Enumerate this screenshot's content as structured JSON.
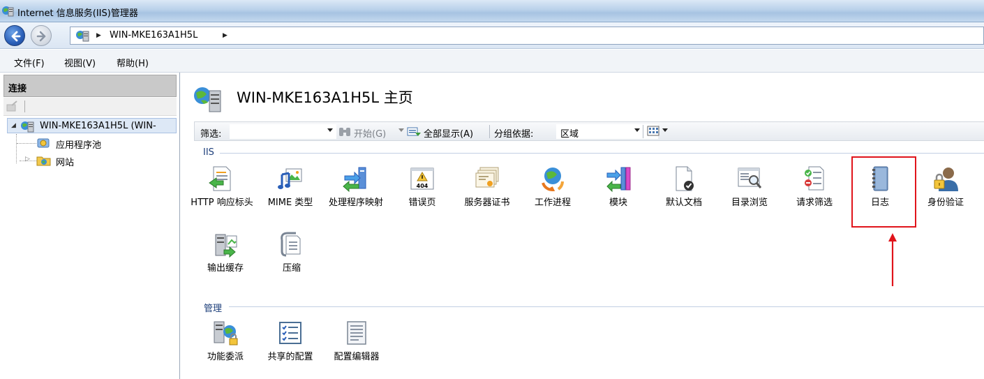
{
  "window": {
    "title": "Internet 信息服务(IIS)管理器"
  },
  "address": {
    "crumb": "WIN-MKE163A1H5L"
  },
  "menu": [
    {
      "label": "文件(F)"
    },
    {
      "label": "视图(V)"
    },
    {
      "label": "帮助(H)"
    }
  ],
  "connections": {
    "header": "连接",
    "tree": {
      "server": "WIN-MKE163A1H5L (WIN-",
      "app_pools": "应用程序池",
      "sites": "网站"
    }
  },
  "main": {
    "title": "WIN-MKE163A1H5L 主页",
    "filter": {
      "label": "筛选:",
      "value": "",
      "go": "开始(G)",
      "show_all": "全部显示(A)",
      "group_by_label": "分组依据:",
      "group_by_value": "区域"
    },
    "groups": {
      "iis": {
        "title": "IIS",
        "items": [
          {
            "label": "HTTP 响应标头",
            "icon": "http-headers-icon"
          },
          {
            "label": "MIME 类型",
            "icon": "mime-icon"
          },
          {
            "label": "处理程序映射",
            "icon": "handler-icon"
          },
          {
            "label": "错误页",
            "icon": "error-page-icon"
          },
          {
            "label": "服务器证书",
            "icon": "certificate-icon"
          },
          {
            "label": "工作进程",
            "icon": "worker-process-icon"
          },
          {
            "label": "模块",
            "icon": "modules-icon"
          },
          {
            "label": "默认文档",
            "icon": "default-document-icon"
          },
          {
            "label": "目录浏览",
            "icon": "directory-browse-icon"
          },
          {
            "label": "请求筛选",
            "icon": "request-filter-icon"
          },
          {
            "label": "日志",
            "icon": "logging-icon"
          },
          {
            "label": "身份验证",
            "icon": "authentication-icon"
          },
          {
            "label": "输出缓存",
            "icon": "output-cache-icon"
          },
          {
            "label": "压缩",
            "icon": "compression-icon"
          }
        ],
        "error_icon_text": "404"
      },
      "manage": {
        "title": "管理",
        "items": [
          {
            "label": "功能委派",
            "icon": "delegation-icon"
          },
          {
            "label": "共享的配置",
            "icon": "shared-config-icon"
          },
          {
            "label": "配置编辑器",
            "icon": "config-editor-icon"
          }
        ]
      }
    }
  },
  "colors": {
    "highlight": "#e0141b",
    "group_title": "#1c3e7a"
  }
}
